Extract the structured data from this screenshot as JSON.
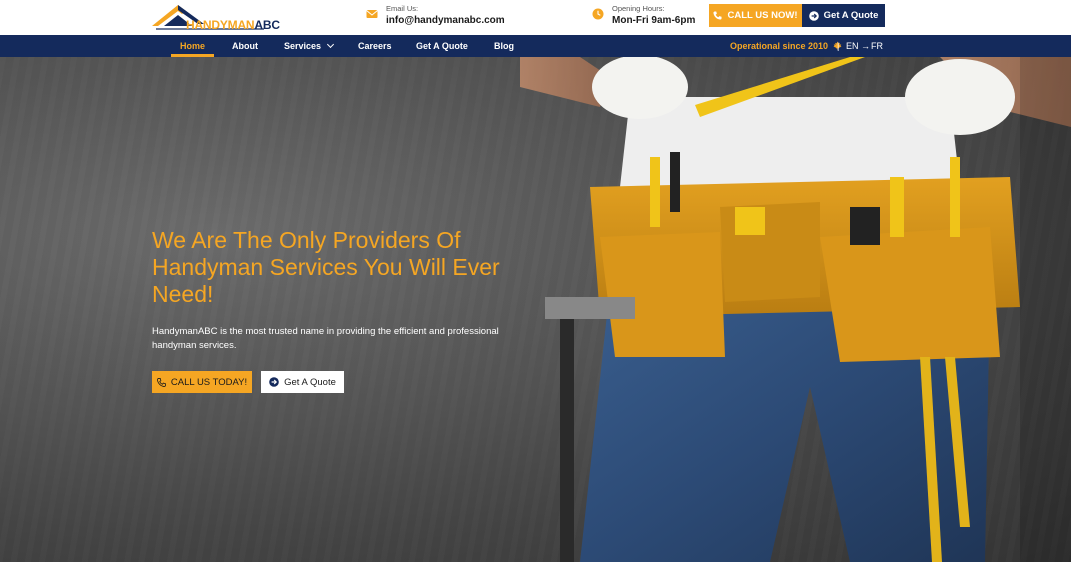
{
  "brand": {
    "logo_part1": "HANDYMAN",
    "logo_part2": "ABC",
    "accent": "#f5a623",
    "navy": "#142a5c"
  },
  "header": {
    "email": {
      "label": "Email Us:",
      "value": "info@handymanabc.com",
      "icon": "envelope-icon"
    },
    "hours": {
      "label": "Opening Hours:",
      "value": "Mon-Fri 9am-6pm",
      "icon": "clock-icon"
    },
    "call_button": "CALL US NOW!",
    "quote_button": "Get A Quote"
  },
  "nav": {
    "items": [
      {
        "label": "Home",
        "active": true
      },
      {
        "label": "About"
      },
      {
        "label": "Services",
        "has_dropdown": true
      },
      {
        "label": "Careers"
      },
      {
        "label": "Get A Quote"
      },
      {
        "label": "Blog"
      }
    ],
    "operational": "Operational since 2010",
    "separator": "|",
    "lang_current": "EN",
    "lang_other": "FR"
  },
  "hero": {
    "title": "We Are The Only Providers Of Handyman Services You Will Ever Need!",
    "description": "HandymanABC is the most trusted name in providing the efficient and professional handyman services.",
    "call_button": "CALL US TODAY!",
    "quote_button": "Get A Quote"
  }
}
